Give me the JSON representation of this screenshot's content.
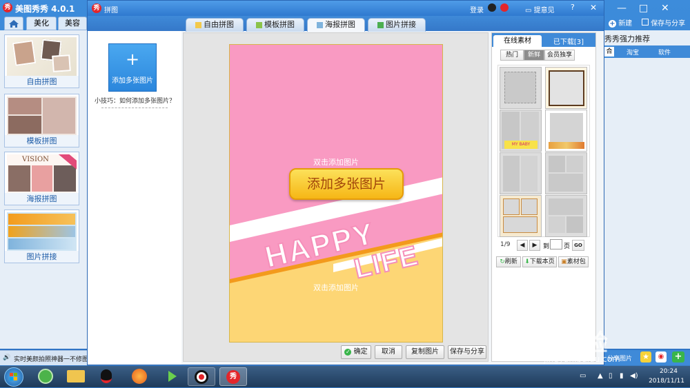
{
  "app": {
    "title": "美图秀秀 4.0.1",
    "nav_tabs": [
      "美化",
      "美容"
    ],
    "left_items": [
      "自由拼图",
      "模板拼图",
      "海报拼图",
      "图片拼接"
    ],
    "status_text": "实时美颜拍照神器一不修图",
    "right_toolbar": {
      "new_label": "新建",
      "save_share_label": "保存与分享"
    },
    "right_title": "秀秀强力推荐",
    "right_tabs": [
      "合",
      "淘宝",
      "软件"
    ],
    "bottom_share_label": "分享图片"
  },
  "dialog": {
    "title": "拼图",
    "login_label": "登录",
    "feedback_label": "提意见",
    "tabs": [
      "自由拼图",
      "模板拼图",
      "海报拼图",
      "图片拼接"
    ],
    "add_multi_label": "添加多张图片",
    "tip_text": "小技巧：如何添加多张图片？",
    "poster": {
      "hint_top": "双击添加图片",
      "hint_bottom": "双击添加图片",
      "add_button": "添加多张图片",
      "banner_word1": "HAPPY",
      "banner_word2": "LIFE",
      "colors": {
        "top": "#f99ac2",
        "bottom": "#fdd675",
        "stripe": "#f39a1c"
      }
    },
    "buttons": {
      "confirm": "确定",
      "cancel": "取消",
      "copy": "复制图片",
      "save_share": "保存与分享"
    },
    "materials": {
      "tab_online": "在线素材",
      "tab_downloaded": "已下载[3]",
      "filters": [
        "热门",
        "新鲜",
        "会员独享"
      ],
      "thumb_text": "MY BABY",
      "pagination": {
        "page": "1/9",
        "go_to_label": "到",
        "page_label": "页",
        "go_button": "GO"
      },
      "actions": {
        "refresh": "刷新",
        "download_page": "下载本页",
        "pack": "素材包"
      }
    }
  },
  "taskbar": {
    "time": "20:24",
    "date": "2018/11/11"
  },
  "watermark": {
    "main": "Bai经验",
    "sub": "jingyan.baidu.com"
  }
}
